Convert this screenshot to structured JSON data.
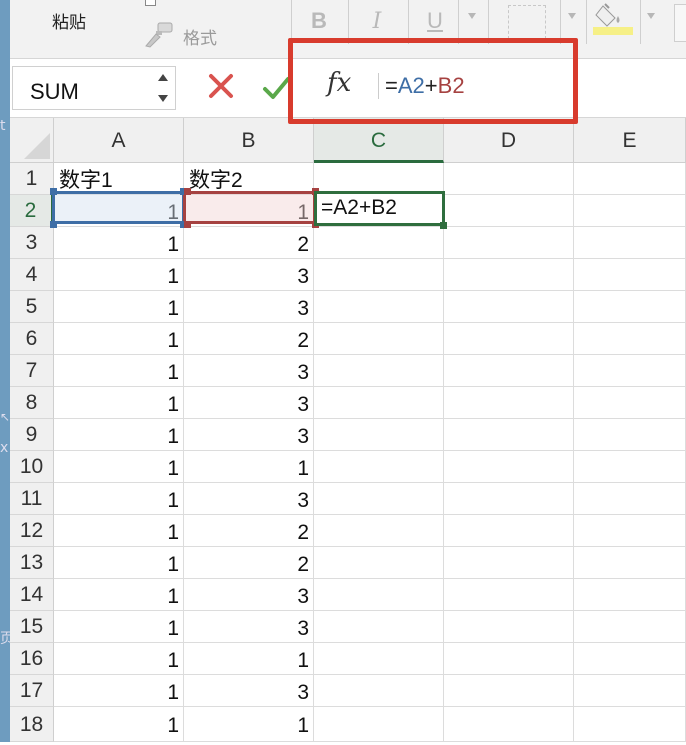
{
  "ribbon": {
    "paste_label": "粘贴",
    "format_painter_label": "格式",
    "bold_label": "B",
    "italic_label": "I",
    "underline_label": "U"
  },
  "formula_bar": {
    "name_box": "SUM",
    "fx_label": "fx",
    "formula_eq": "=",
    "formula_ref_a": "A2",
    "formula_plus": "+",
    "formula_ref_b": "B2"
  },
  "desktop_glyphs": [
    "t",
    "↖",
    "x",
    "页"
  ],
  "sheet": {
    "columns": [
      "A",
      "B",
      "C",
      "D",
      "E"
    ],
    "active_column": "C",
    "active_row": "2",
    "rows": [
      {
        "n": "1",
        "a": "数字1",
        "b": "数字2",
        "c": ""
      },
      {
        "n": "2",
        "a": "1",
        "b": "1",
        "c": "=A2+B2"
      },
      {
        "n": "3",
        "a": "1",
        "b": "2",
        "c": ""
      },
      {
        "n": "4",
        "a": "1",
        "b": "3",
        "c": ""
      },
      {
        "n": "5",
        "a": "1",
        "b": "3",
        "c": ""
      },
      {
        "n": "6",
        "a": "1",
        "b": "2",
        "c": ""
      },
      {
        "n": "7",
        "a": "1",
        "b": "3",
        "c": ""
      },
      {
        "n": "8",
        "a": "1",
        "b": "3",
        "c": ""
      },
      {
        "n": "9",
        "a": "1",
        "b": "3",
        "c": ""
      },
      {
        "n": "10",
        "a": "1",
        "b": "1",
        "c": ""
      },
      {
        "n": "11",
        "a": "1",
        "b": "3",
        "c": ""
      },
      {
        "n": "12",
        "a": "1",
        "b": "2",
        "c": ""
      },
      {
        "n": "13",
        "a": "1",
        "b": "2",
        "c": ""
      },
      {
        "n": "14",
        "a": "1",
        "b": "3",
        "c": ""
      },
      {
        "n": "15",
        "a": "1",
        "b": "3",
        "c": ""
      },
      {
        "n": "16",
        "a": "1",
        "b": "1",
        "c": ""
      },
      {
        "n": "17",
        "a": "1",
        "b": "3",
        "c": ""
      },
      {
        "n": "18",
        "a": "1",
        "b": "1",
        "c": ""
      }
    ]
  },
  "colors": {
    "ref_a": "#3e6ea6",
    "ref_b": "#a64241",
    "active_cell": "#2f6e3e",
    "highlight_box": "#d83b2d"
  }
}
